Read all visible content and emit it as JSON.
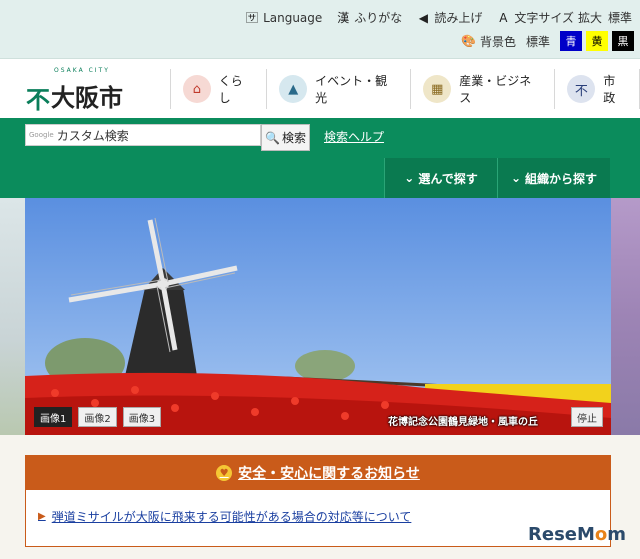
{
  "utility": {
    "language": "Language",
    "furigana": "ふりがな",
    "read_aloud": "読み上げ",
    "text_size_label": "文字サイズ",
    "text_size_enlarge": "拡大",
    "text_size_standard": "標準",
    "bg_color_label": "背景色",
    "bg_standard": "標準",
    "bg_blue": "青",
    "bg_yellow": "黄",
    "bg_black": "黒"
  },
  "logo": {
    "sub": "OSAKA CITY",
    "text": "大阪市"
  },
  "global_nav": [
    {
      "label": "くらし",
      "icon": "house-icon",
      "color": "#f6d9d4"
    },
    {
      "label": "イベント・観光",
      "icon": "castle-icon",
      "color": "#d6e8ef"
    },
    {
      "label": "産業・ビジネス",
      "icon": "building-icon",
      "color": "#efe6c8"
    },
    {
      "label": "市政",
      "icon": "city-emblem-icon",
      "color": "#dde3ef"
    }
  ],
  "search": {
    "placeholder": "カスタム検索",
    "google_label": "Google",
    "button": "検索",
    "help": "検索ヘルプ"
  },
  "sub_nav": {
    "choose": "選んで探す",
    "org": "組織から探す"
  },
  "hero": {
    "tabs": [
      "画像1",
      "画像2",
      "画像3"
    ],
    "caption": "花博記念公園鶴見緑地・風車の丘",
    "stop": "停止"
  },
  "notice": {
    "title": "安全・安心に関するお知らせ",
    "items": [
      "弾道ミサイルが大阪に飛来する可能性がある場合の対応等について"
    ]
  },
  "watermark": {
    "text_a": "ReseM",
    "text_o": "o",
    "text_b": "m"
  },
  "colors": {
    "brand_green": "#0b8c5c",
    "notice_orange": "#c95b1a",
    "link_blue": "#1a3fa0"
  }
}
